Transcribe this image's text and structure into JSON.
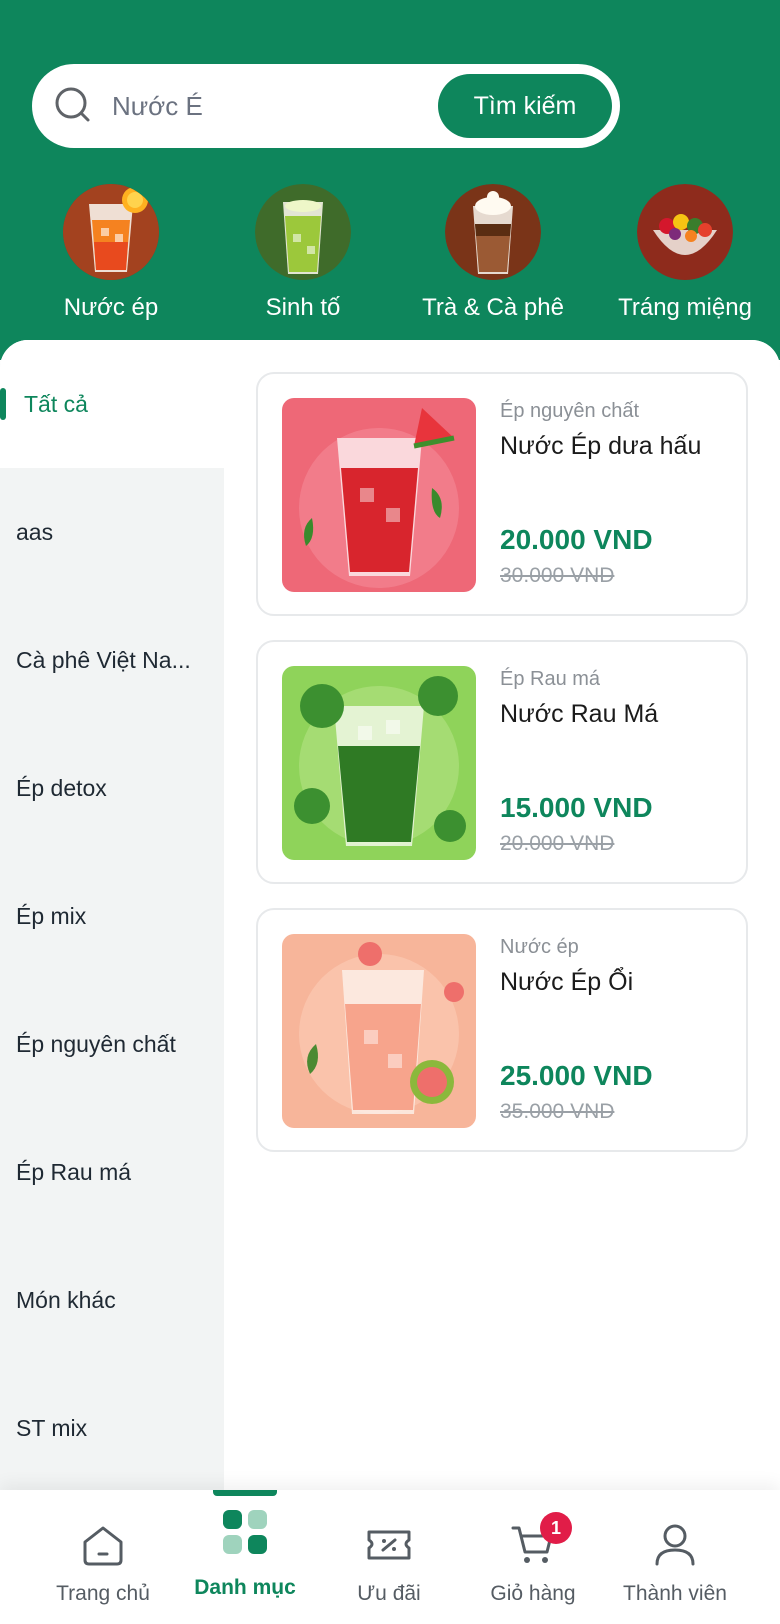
{
  "search": {
    "value": "Nước É",
    "button_label": "Tìm kiếm"
  },
  "categories": [
    {
      "label": "Nước ép",
      "icon": "orange-juice-drink"
    },
    {
      "label": "Sinh tố",
      "icon": "green-smoothie-drink"
    },
    {
      "label": "Trà & Cà phê",
      "icon": "coffee-drink"
    },
    {
      "label": "Tráng miệng",
      "icon": "fruit-bowl-dessert"
    }
  ],
  "sidebar": {
    "items": [
      {
        "label": "Tất cả",
        "active": true
      },
      {
        "label": "aas"
      },
      {
        "label": "Cà phê Việt Na..."
      },
      {
        "label": "Ép detox"
      },
      {
        "label": "Ép mix"
      },
      {
        "label": "Ép nguyên chất"
      },
      {
        "label": "Ép Rau má"
      },
      {
        "label": "Món khác"
      },
      {
        "label": "ST mix"
      }
    ]
  },
  "products": [
    {
      "category": "Ép nguyên chất",
      "name": "Nước Ép dưa hấu",
      "price": "20.000 VND",
      "old_price": "30.000 VND",
      "image": "watermelon-juice"
    },
    {
      "category": "Ép Rau má",
      "name": "Nước Rau Má",
      "price": "15.000 VND",
      "old_price": "20.000 VND",
      "image": "pennywort-juice"
    },
    {
      "category": "Nước ép",
      "name": "Nước Ép Ổi",
      "price": "25.000 VND",
      "old_price": "35.000 VND",
      "image": "guava-juice"
    }
  ],
  "nav": {
    "items": [
      {
        "label": "Trang chủ",
        "icon": "home-icon"
      },
      {
        "label": "Danh mục",
        "icon": "grid-icon",
        "active": true
      },
      {
        "label": "Ưu đãi",
        "icon": "ticket-icon"
      },
      {
        "label": "Giỏ hàng",
        "icon": "cart-icon",
        "badge": "1"
      },
      {
        "label": "Thành viên",
        "icon": "user-icon"
      }
    ]
  },
  "colors": {
    "brand": "#0e865c",
    "badge": "#e11d48"
  }
}
